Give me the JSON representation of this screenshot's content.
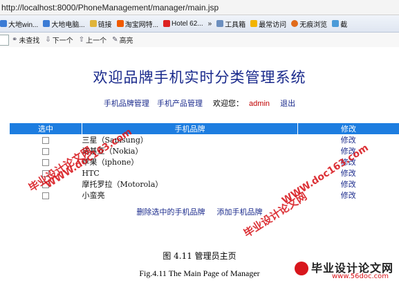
{
  "browser": {
    "url": "http://localhost:8000/PhoneManagement/manager/main.jsp",
    "bookmarks": [
      {
        "label": "大地win...",
        "icon": "page-icon"
      },
      {
        "label": "大地电脑...",
        "icon": "page-icon"
      },
      {
        "label": "链接",
        "icon": "folder-icon"
      },
      {
        "label": "淘宝网特...",
        "icon": "taobao-icon"
      },
      {
        "label": "Hotel 62...",
        "icon": "hotel-icon"
      },
      {
        "label": "工具箱",
        "icon": "toolbox-icon"
      },
      {
        "label": "最常访问",
        "icon": "star-icon"
      },
      {
        "label": "无痕浏览",
        "icon": "incognito-icon"
      },
      {
        "label": "截",
        "icon": "screenshot-icon"
      }
    ],
    "more": "»",
    "find": {
      "not_found": "未查找",
      "next": "下一个",
      "prev": "上一个",
      "highlight": "高亮"
    }
  },
  "page": {
    "title": "欢迎品牌手机实时分类管理系统",
    "nav": {
      "brand_mgmt": "手机品牌管理",
      "product_mgmt": "手机产品管理",
      "welcome": "欢迎您：",
      "user": "admin",
      "logout": "退出"
    },
    "table": {
      "headers": {
        "select": "选中",
        "brand": "手机品牌",
        "edit": "修改"
      },
      "rows": [
        {
          "name": "三星（Samsung）",
          "edit": "修改"
        },
        {
          "name": "诺基亚（Nokia）",
          "edit": "修改"
        },
        {
          "name": "苹果（iphone）",
          "edit": "修改"
        },
        {
          "name": "HTC",
          "edit": "修改"
        },
        {
          "name": "摩托罗拉（Motorola）",
          "edit": "修改"
        },
        {
          "name": "小蛮亮",
          "edit": "修改"
        }
      ]
    },
    "actions": {
      "delete_selected": "删除选中的手机品牌",
      "add_brand": "添加手机品牌"
    }
  },
  "caption": {
    "cn": "图 4.11   管理员主页",
    "en": "Fig.4.11    The Main Page of Manager"
  },
  "watermarks": {
    "w1": "毕业设计论文网",
    "w2": "WWW.doc163.com",
    "w3": "毕业设计论文网",
    "w4": "WWW.doc163.com",
    "logo_text": "毕业设计论文网",
    "logo_url": "www.56doc.com"
  },
  "colors": {
    "header_bg": "#1d7de0",
    "title": "#1a2a8c",
    "admin": "#c00000",
    "watermark": "#d8161c"
  }
}
